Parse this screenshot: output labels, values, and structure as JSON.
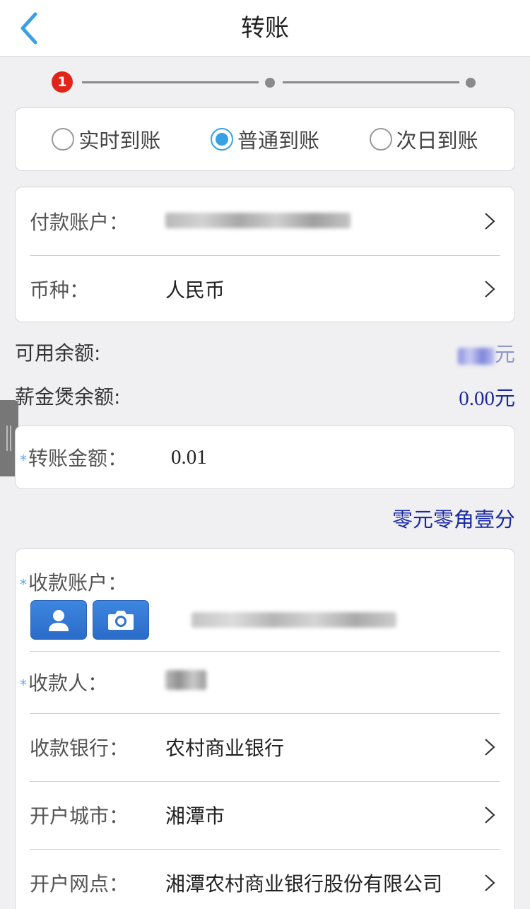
{
  "header": {
    "title": "转账"
  },
  "stepper": {
    "current_step": "1"
  },
  "transfer_modes": {
    "options": [
      "实时到账",
      "普通到账",
      "次日到账"
    ],
    "selected_index": 1
  },
  "payer": {
    "account_label": "付款账户：",
    "currency_label": "币种：",
    "currency_value": "人民币"
  },
  "balances": {
    "available_label": "可用余额:",
    "available_unit": "元",
    "salary_label": "薪金煲余额:",
    "salary_value": "0.00元"
  },
  "amount": {
    "required_mark": "*",
    "label": "转账金额：",
    "value": "0.01",
    "chinese_uppercase": "零元零角壹分"
  },
  "payee": {
    "required_mark": "*",
    "account_label": "收款账户：",
    "name_label": "收款人：",
    "bank_label": "收款银行：",
    "bank_value": "农村商业银行",
    "city_label": "开户城市：",
    "city_value": "湘潭市",
    "branch_label": "开户网点：",
    "branch_value": "湘潭农村商业银行股份有限公司"
  },
  "colors": {
    "accent": "#3aa0e4",
    "amount_blue": "#1a2aa5",
    "badge_red": "#e2231a"
  }
}
